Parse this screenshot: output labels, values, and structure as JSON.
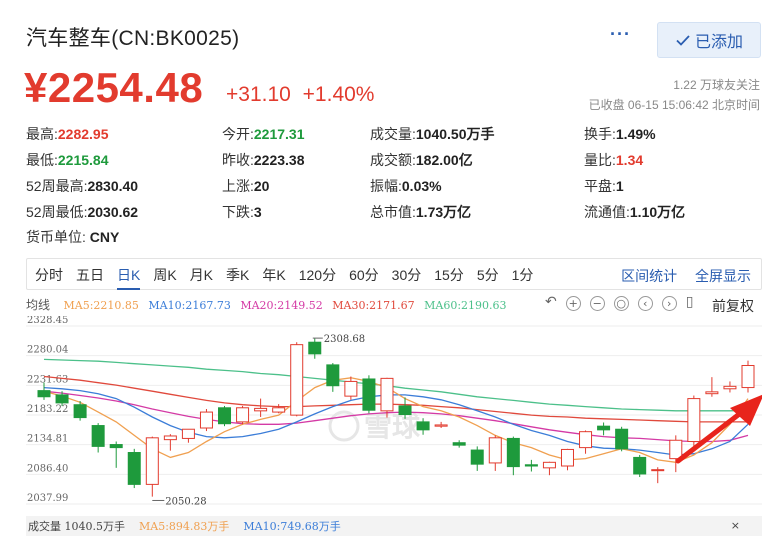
{
  "header": {
    "title": "汽车整车(CN:BK0025)",
    "more_label": "···",
    "added_label": "已添加"
  },
  "price": {
    "current": "¥2254.48",
    "change": "+31.10",
    "change_pct": "+1.40%",
    "followers": "1.22 万球友关注",
    "status": "已收盘 06-15 15:06:42 北京时间"
  },
  "quote": {
    "high_k": "最高:",
    "high_v": "2282.95",
    "low_k": "最低:",
    "low_v": "2215.84",
    "w52h_k": "52周最高:",
    "w52h_v": "2830.40",
    "w52l_k": "52周最低:",
    "w52l_v": "2030.62",
    "cur_k": "货币单位:",
    "cur_v": "CNY",
    "open_k": "今开:",
    "open_v": "2217.31",
    "prev_k": "昨收:",
    "prev_v": "2223.38",
    "rise_k": "上涨:",
    "rise_v": "20",
    "fall_k": "下跌:",
    "fall_v": "3",
    "vol_k": "成交量:",
    "vol_v": "1040.50万手",
    "amt_k": "成交额:",
    "amt_v": "182.00亿",
    "amp_k": "振幅:",
    "amp_v": "0.03%",
    "mcap_k": "总市值:",
    "mcap_v": "1.73万亿",
    "turn_k": "换手:",
    "turn_v": "1.49%",
    "ratio_k": "量比:",
    "ratio_v": "1.34",
    "flat_k": "平盘:",
    "flat_v": "1",
    "float_k": "流通值:",
    "float_v": "1.10万亿"
  },
  "tabs": [
    "分时",
    "五日",
    "日K",
    "周K",
    "月K",
    "季K",
    "年K",
    "120分",
    "60分",
    "30分",
    "15分",
    "5分",
    "1分"
  ],
  "active_tab": 2,
  "tab_right": {
    "interval": "区间统计",
    "fullscreen": "全屏显示"
  },
  "ma_legend": {
    "label": "均线",
    "ma5": "MA5:2210.85",
    "ma10": "MA10:2167.73",
    "ma20": "MA20:2149.52",
    "ma30": "MA30:2171.67",
    "ma60": "MA60:2190.63"
  },
  "colors": {
    "up": "#e23b2e",
    "down": "#1e9a3c",
    "ma5": "#f0a050",
    "ma10": "#3b7dd8",
    "ma20": "#d43aa5",
    "ma30": "#e0493c",
    "ma60": "#4cc08a",
    "accent": "#2a5db0",
    "arrow": "#e8241c"
  },
  "chart_tools": {
    "undo": "undo-icon",
    "zoom_in": "+",
    "zoom_out": "−",
    "reset": "reset-icon",
    "adjust": "前复权"
  },
  "volume": {
    "label": "成交量 1040.5万手",
    "ma5": "MA5:894.83万手",
    "ma10": "MA10:749.68万手",
    "close": "×"
  },
  "watermark": "雪球",
  "chart_data": {
    "type": "candlestick",
    "y_ticks": [
      2328.45,
      2280.04,
      2231.63,
      2183.22,
      2134.81,
      2086.4,
      2037.99
    ],
    "y_tick_labels": [
      "2328.45",
      "2280.04",
      "2231.63",
      "2183.22",
      "2134.81",
      "2086.40",
      "2037.99"
    ],
    "ylim": [
      2037.99,
      2328.45
    ],
    "annotations": [
      {
        "label": "2308.68",
        "value": 2308.68,
        "index": 15
      },
      {
        "label": "2050.28",
        "value": 2050.28,
        "index": 6
      }
    ],
    "candles": [
      [
        2223,
        2236,
        2208,
        2213
      ],
      [
        2216,
        2222,
        2198,
        2203
      ],
      [
        2200,
        2206,
        2174,
        2179
      ],
      [
        2166,
        2170,
        2122,
        2132
      ],
      [
        2135,
        2140,
        2097,
        2130
      ],
      [
        2122,
        2128,
        2064,
        2070
      ],
      [
        2070,
        2148,
        2050,
        2146
      ],
      [
        2143,
        2152,
        2125,
        2149
      ],
      [
        2145,
        2160,
        2138,
        2160
      ],
      [
        2162,
        2193,
        2157,
        2188
      ],
      [
        2195,
        2198,
        2165,
        2169
      ],
      [
        2172,
        2198,
        2168,
        2195
      ],
      [
        2190,
        2210,
        2180,
        2194
      ],
      [
        2188,
        2201,
        2186,
        2195
      ],
      [
        2183,
        2302,
        2181,
        2298
      ],
      [
        2302,
        2308,
        2275,
        2283
      ],
      [
        2265,
        2268,
        2221,
        2231
      ],
      [
        2214,
        2246,
        2208,
        2238
      ],
      [
        2242,
        2248,
        2186,
        2191
      ],
      [
        2190,
        2244,
        2179,
        2243
      ],
      [
        2198,
        2212,
        2177,
        2184
      ],
      [
        2172,
        2178,
        2151,
        2159
      ],
      [
        2165,
        2172,
        2162,
        2167
      ],
      [
        2138,
        2142,
        2130,
        2134
      ],
      [
        2126,
        2132,
        2092,
        2103
      ],
      [
        2105,
        2150,
        2092,
        2146
      ],
      [
        2145,
        2148,
        2085,
        2099
      ],
      [
        2102,
        2110,
        2091,
        2100
      ],
      [
        2097,
        2107,
        2085,
        2106
      ],
      [
        2100,
        2128,
        2093,
        2127
      ],
      [
        2130,
        2158,
        2120,
        2156
      ],
      [
        2165,
        2171,
        2150,
        2159
      ],
      [
        2160,
        2164,
        2124,
        2128
      ],
      [
        2114,
        2118,
        2082,
        2087
      ],
      [
        2094,
        2098,
        2072,
        2094
      ],
      [
        2112,
        2150,
        2090,
        2142
      ],
      [
        2140,
        2215,
        2130,
        2210
      ],
      [
        2218,
        2245,
        2213,
        2221
      ],
      [
        2226,
        2238,
        2220,
        2230
      ],
      [
        2228,
        2272,
        2220,
        2264
      ]
    ],
    "ma5": [
      2222,
      2214,
      2204,
      2188,
      2172,
      2150,
      2128,
      2114,
      2122,
      2140,
      2156,
      2168,
      2176,
      2183,
      2206,
      2228,
      2240,
      2244,
      2238,
      2228,
      2210,
      2197,
      2190,
      2180,
      2166,
      2150,
      2138,
      2130,
      2118,
      2110,
      2112,
      2120,
      2128,
      2122,
      2110,
      2106,
      2118,
      2138,
      2168,
      2210
    ],
    "ma10": [
      2228,
      2226,
      2223,
      2218,
      2210,
      2196,
      2180,
      2166,
      2155,
      2148,
      2146,
      2148,
      2153,
      2160,
      2172,
      2185,
      2197,
      2207,
      2213,
      2216,
      2216,
      2213,
      2208,
      2200,
      2190,
      2180,
      2168,
      2158,
      2150,
      2140,
      2133,
      2129,
      2128,
      2126,
      2122,
      2118,
      2120,
      2128,
      2140,
      2168
    ],
    "ma20": [
      2222,
      2219,
      2215,
      2211,
      2206,
      2200,
      2193,
      2187,
      2181,
      2176,
      2172,
      2169,
      2168,
      2168,
      2170,
      2174,
      2178,
      2182,
      2185,
      2187,
      2188,
      2187,
      2185,
      2182,
      2178,
      2174,
      2169,
      2164,
      2159,
      2155,
      2151,
      2148,
      2146,
      2145,
      2143,
      2141,
      2140,
      2140,
      2142,
      2150
    ],
    "ma30": [
      2246,
      2243,
      2240,
      2236,
      2232,
      2227,
      2222,
      2217,
      2212,
      2207,
      2203,
      2200,
      2198,
      2197,
      2197,
      2198,
      2199,
      2200,
      2201,
      2201,
      2200,
      2199,
      2197,
      2195,
      2192,
      2189,
      2186,
      2183,
      2181,
      2180,
      2178,
      2177,
      2176,
      2175,
      2174,
      2173,
      2172,
      2172,
      2172,
      2172
    ],
    "ma60": [
      2274,
      2273,
      2272,
      2271,
      2269,
      2267,
      2265,
      2263,
      2261,
      2258,
      2256,
      2254,
      2251,
      2249,
      2246,
      2243,
      2240,
      2237,
      2234,
      2231,
      2227,
      2224,
      2221,
      2217,
      2213,
      2210,
      2207,
      2204,
      2201,
      2199,
      2197,
      2195,
      2193,
      2192,
      2191,
      2190,
      2190,
      2190,
      2190,
      2191
    ]
  }
}
